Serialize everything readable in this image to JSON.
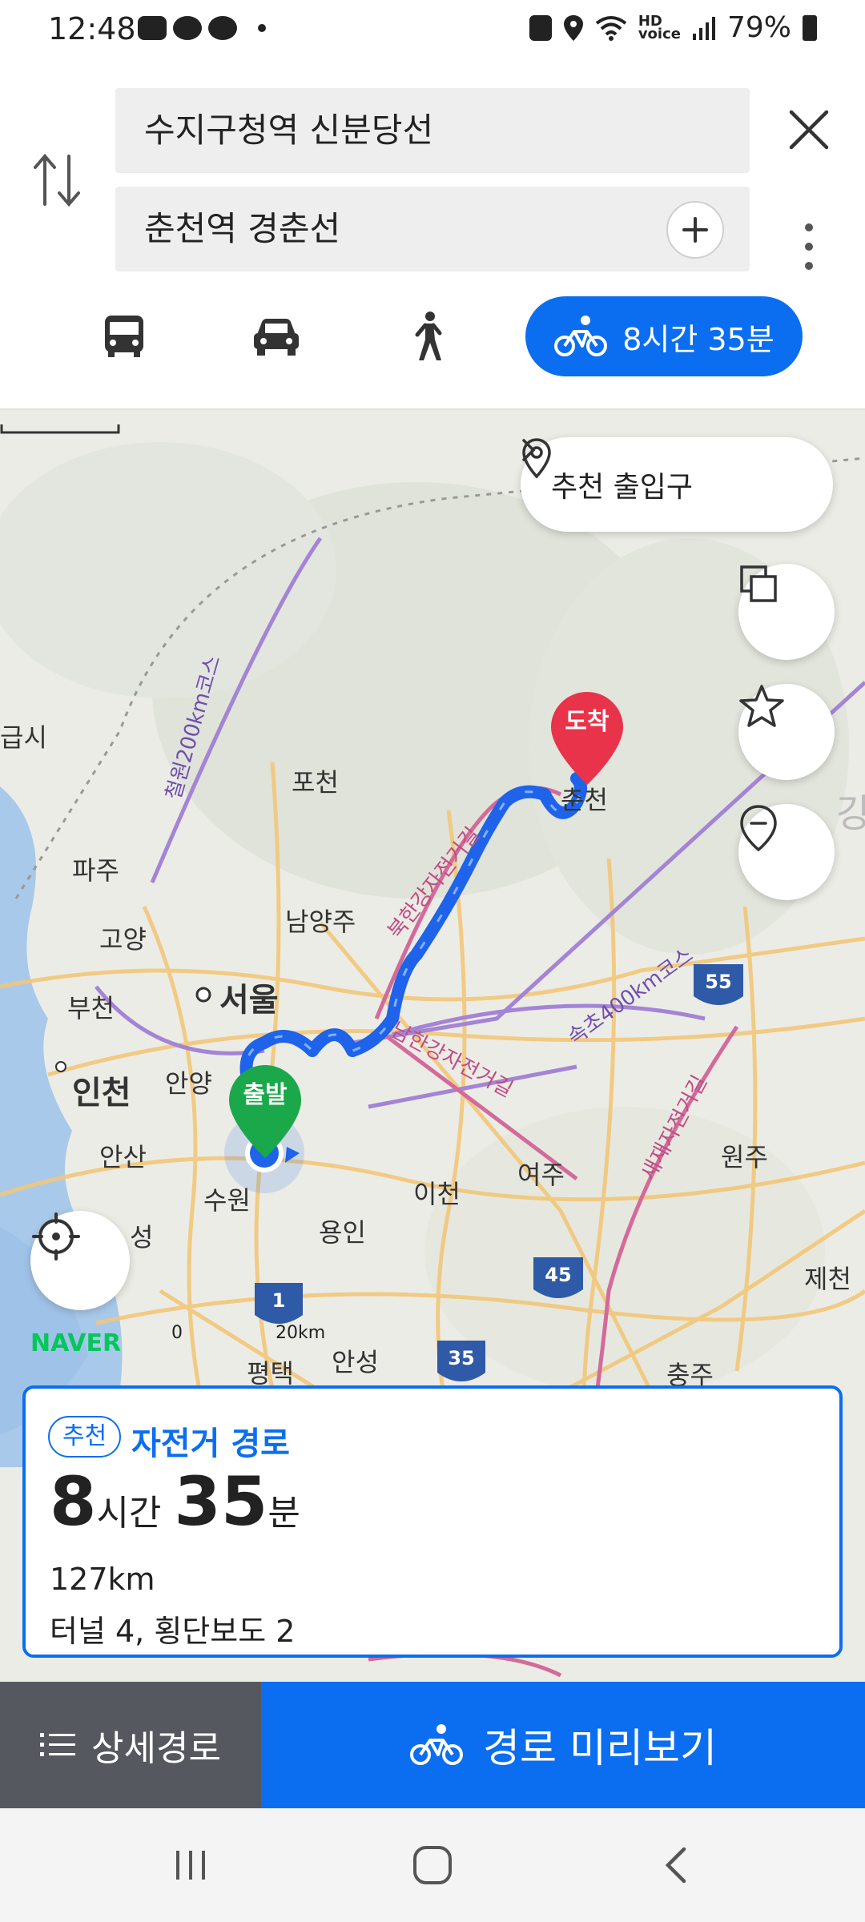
{
  "status_bar": {
    "time": "12:48",
    "battery": "79%",
    "icons": [
      "youtube-icon",
      "threads-icon",
      "band-icon",
      "dot-icon",
      "recycle-icon",
      "location-icon",
      "wifi-icon",
      "hd-voice-icon",
      "signal-icon",
      "battery-icon"
    ]
  },
  "search": {
    "origin": "수지구청역 신분당선",
    "destination": "춘천역 경춘선"
  },
  "modes": {
    "bike_label": "8시간 35분",
    "selected": "bike"
  },
  "map": {
    "recommend_chip": "추천 출입구",
    "end_pin": "도착",
    "start_pin": "출발",
    "logo": "NAVER",
    "scale_start": "0",
    "scale_end": "20km",
    "labels": {
      "poemcheon": "포천",
      "chuncheon": "춘천",
      "paju": "파주",
      "namyangju": "남양주",
      "goyang": "고양",
      "seoul": "서울",
      "bucheon": "부천",
      "incheon": "인천",
      "anyang": "안양",
      "ansan": "안산",
      "suwon": "수원",
      "yongin": "용인",
      "icheon": "이천",
      "yeoju": "여주",
      "wonju": "원주",
      "jecheon": "제천",
      "pyeongtaek": "평택",
      "anseong": "안성",
      "chungju": "충주",
      "siheung": "급시",
      "hwaseong": "성",
      "gang": "강",
      "route_cheorwon": "철원200km코스",
      "route_bukhan": "북한강자전거길",
      "route_namhan": "남한강자전거길",
      "route_sokcho": "속초400km코스",
      "route_saejae": "새재자전거길",
      "hw_55": "55",
      "hw_45": "45",
      "hw_1": "1",
      "hw_35": "35"
    }
  },
  "route_card": {
    "badge": "추천",
    "title": "자전거 경로",
    "hours_num": "8",
    "hours_unit": "시간",
    "minutes_num": "35",
    "minutes_unit": "분",
    "distance": "127km",
    "detail": "터널 4, 횡단보도 2"
  },
  "bottom_bar": {
    "detail_label": "상세경로",
    "preview_label": "경로 미리보기"
  },
  "colors": {
    "accent": "#0b6ef0",
    "end_pin": "#e8334a",
    "start_pin": "#1ba84b",
    "detail_bg": "#55595f"
  }
}
